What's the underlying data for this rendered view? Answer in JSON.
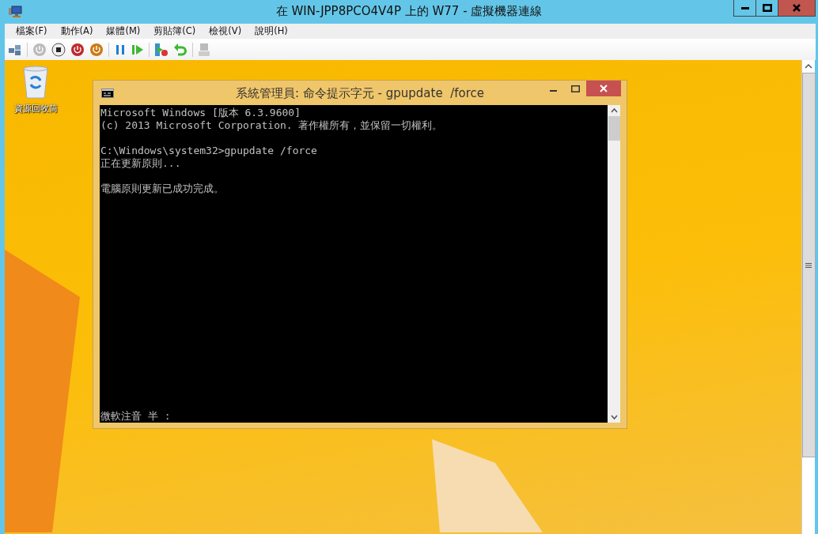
{
  "window": {
    "title": "在 WIN-JPP8PCO4V4P 上的 W77 - 虛擬機器連線"
  },
  "menu": [
    "檔案(F)",
    "動作(A)",
    "媒體(M)",
    "剪貼簿(C)",
    "檢視(V)",
    "說明(H)"
  ],
  "desktop": {
    "icons": [
      {
        "label": "資源回收筒"
      }
    ]
  },
  "console_window": {
    "title": "系統管理員: 命令提示字元 - gpupdate  /force",
    "paragraphs": [
      [
        "Microsoft Windows [版本 6.3.9600]",
        "(c) 2013 Microsoft Corporation. 著作權所有，並保留一切權利。"
      ],
      [
        "C:\\Windows\\system32>gpupdate /force",
        "正在更新原則..."
      ],
      [
        "電腦原則更新已成功完成。"
      ]
    ],
    "ime_status": "微軟注音 半 :"
  }
}
